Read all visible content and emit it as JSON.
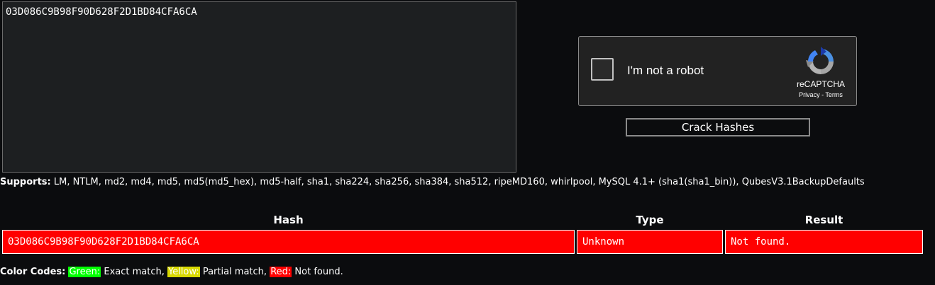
{
  "input": {
    "value": "03D086C9B98F90D628F2D1BD84CFA6CA"
  },
  "captcha": {
    "label": "I'm not a robot",
    "brand": "reCAPTCHA",
    "privacy_link": "Privacy",
    "separator": " - ",
    "terms_link": "Terms"
  },
  "crack_button_label": "Crack Hashes",
  "supports": {
    "label": "Supports:",
    "list": " LM, NTLM, md2, md4, md5, md5(md5_hex), md5-half, sha1, sha224, sha256, sha384, sha512, ripeMD160, whirlpool, MySQL 4.1+ (sha1(sha1_bin)), QubesV3.1BackupDefaults"
  },
  "results_table": {
    "headers": [
      "Hash",
      "Type",
      "Result"
    ],
    "rows": [
      {
        "hash": "03D086C9B98F90D628F2D1BD84CFA6CA",
        "type": "Unknown",
        "result": "Not found.",
        "status_color": "#ff0000"
      }
    ]
  },
  "color_codes": {
    "label": "Color Codes:",
    "green": {
      "swatch": "Green:",
      "text": " Exact match, ",
      "color": "#00ff00"
    },
    "yellow": {
      "swatch": "Yellow:",
      "text": " Partial match, ",
      "color": "#d8d800"
    },
    "red": {
      "swatch": "Red:",
      "text": " Not found.",
      "color": "#ff0000"
    }
  },
  "icons": {
    "captcha_logo": "recaptcha-logo-icon"
  }
}
